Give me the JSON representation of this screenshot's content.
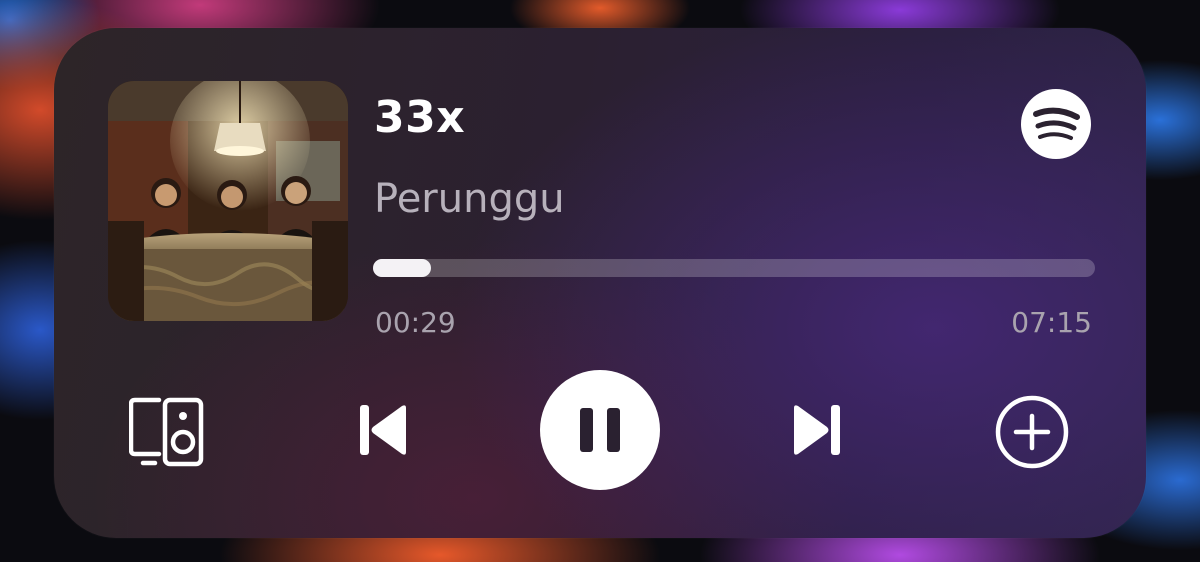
{
  "track": {
    "title": "33x",
    "artist": "Perunggu",
    "progress_fraction": 0.08
  },
  "time": {
    "elapsed": "00:29",
    "total": "07:15"
  },
  "app_icon": "spotify-logo-icon",
  "controls": {
    "device": "connect-device-icon",
    "previous": "skip-previous-icon",
    "play_state": "playing",
    "play_pause": "pause-icon",
    "next": "skip-next-icon",
    "add": "add-circle-icon"
  },
  "colors": {
    "accent": "#ffffff",
    "secondary_text": "#b7b1bb",
    "time_text": "#a9a3ae"
  }
}
